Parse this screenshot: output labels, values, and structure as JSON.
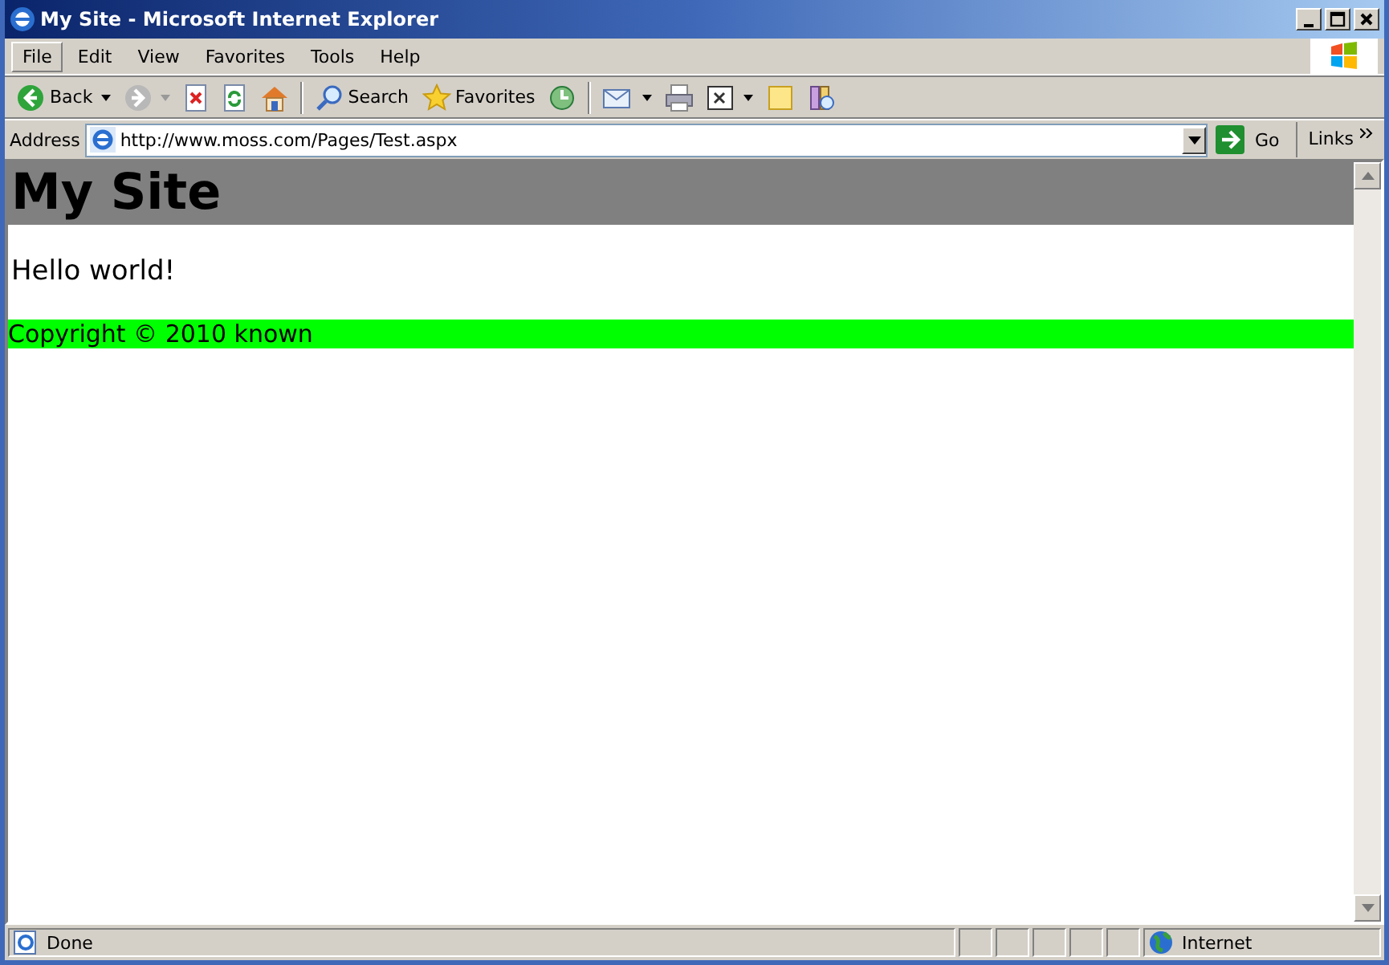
{
  "window": {
    "title": "My Site - Microsoft Internet Explorer"
  },
  "menu": [
    {
      "label": "File",
      "selected": true
    },
    {
      "label": "Edit",
      "selected": false
    },
    {
      "label": "View",
      "selected": false
    },
    {
      "label": "Favorites",
      "selected": false
    },
    {
      "label": "Tools",
      "selected": false
    },
    {
      "label": "Help",
      "selected": false
    }
  ],
  "toolbar": [
    {
      "kind": "back",
      "label": "Back",
      "disabled": false
    },
    {
      "kind": "forward",
      "disabled": true
    },
    {
      "kind": "stop"
    },
    {
      "kind": "refresh"
    },
    {
      "kind": "home"
    },
    {
      "kind": "separator"
    },
    {
      "kind": "search",
      "label": "Search"
    },
    {
      "kind": "favorites",
      "label": "Favorites"
    },
    {
      "kind": "history"
    },
    {
      "kind": "separator"
    },
    {
      "kind": "mail"
    },
    {
      "kind": "print"
    },
    {
      "kind": "edit"
    },
    {
      "kind": "note"
    },
    {
      "kind": "research"
    }
  ],
  "address": {
    "label": "Address",
    "value": "http://www.moss.com/Pages/Test.aspx",
    "go": "Go",
    "links": "Links"
  },
  "page": {
    "heading": "My Site",
    "paragraph": "Hello world!",
    "footer": "Copyright © 2010 known"
  },
  "status_bar": {
    "text": "Done",
    "zone": "Internet"
  }
}
